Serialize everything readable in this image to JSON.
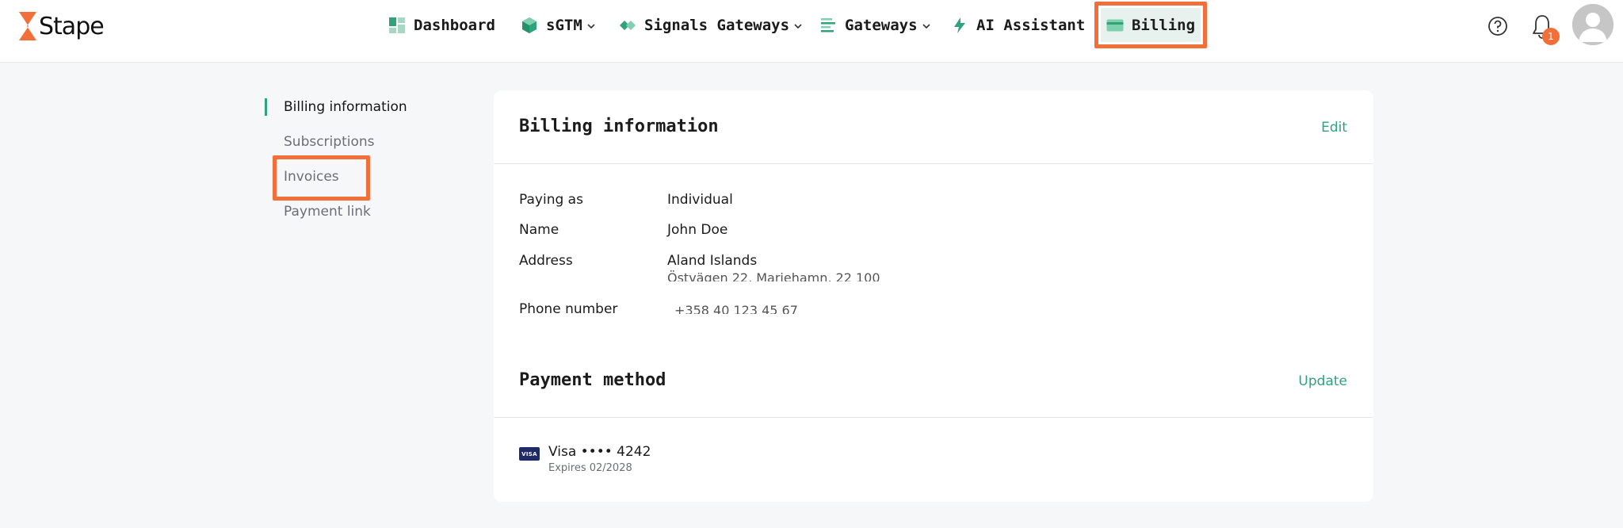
{
  "brand": {
    "name": "Stape",
    "accent": "#2fa37a",
    "highlight": "#f26f3a"
  },
  "nav": {
    "dashboard": "Dashboard",
    "sgtm": "sGTM",
    "signals_gateways": "Signals Gateways",
    "gateways": "Gateways",
    "ai_assistant": "AI Assistant",
    "billing": "Billing"
  },
  "notifications": {
    "count": "1"
  },
  "sidebar": {
    "items": [
      {
        "label": "Billing information",
        "active": true
      },
      {
        "label": "Subscriptions",
        "active": false
      },
      {
        "label": "Invoices",
        "active": false
      },
      {
        "label": "Payment link",
        "active": false
      }
    ]
  },
  "billing_info": {
    "title": "Billing information",
    "edit_label": "Edit",
    "rows": [
      {
        "label": "Paying as",
        "value": "Individual"
      },
      {
        "label": "Name",
        "value": "John Doe"
      },
      {
        "label": "Address",
        "value": "Aland Islands",
        "value2": "Östvägen 22, Mariehamn, 22 100"
      },
      {
        "label": "Phone number",
        "value": "+358 40 123 45 67"
      }
    ]
  },
  "payment_method": {
    "title": "Payment method",
    "update_label": "Update",
    "card_brand_badge": "VISA",
    "card_number": "Visa •••• 4242",
    "expires": "Expires 02/2028"
  }
}
